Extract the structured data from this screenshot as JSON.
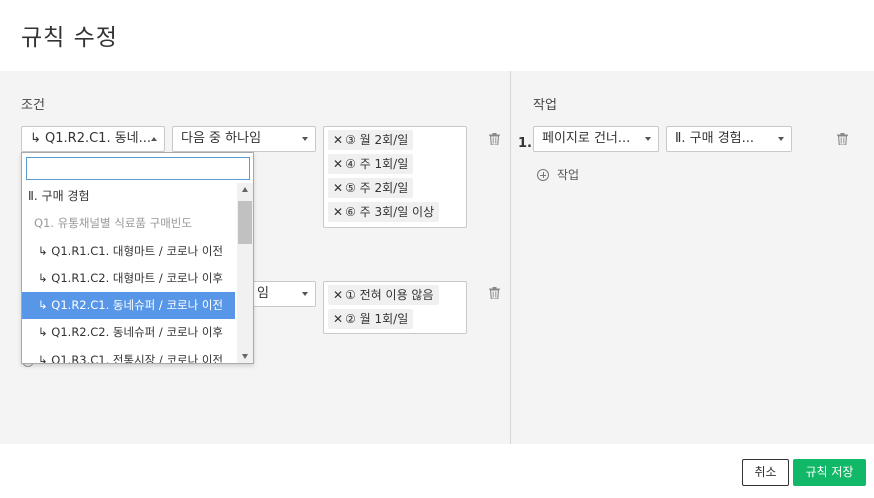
{
  "dialog": {
    "title": "규칙 수정"
  },
  "conditions": {
    "label": "조건",
    "row1": {
      "field": "↳ Q1.R2.C1. 동네...",
      "operator": "다음 중 하나임",
      "tags": [
        "③ 월 2회/일",
        "④ 주 1회/일",
        "⑤ 주 2회/일",
        "⑥ 주 3회/일 이상"
      ]
    },
    "row2": {
      "operator": "임",
      "tags": [
        "① 전혀 이용 않음",
        "② 월 1회/일"
      ]
    }
  },
  "dropdown": {
    "search_value": "",
    "options": [
      {
        "label": "Ⅱ. 구매 경험",
        "kind": "group"
      },
      {
        "label": "Q1. 유통채널별 식료품 구매빈도",
        "kind": "subgroup"
      },
      {
        "label": "↳ Q1.R1.C1. 대형마트 / 코로나 이전",
        "kind": "item"
      },
      {
        "label": "↳ Q1.R1.C2. 대형마트 / 코로나 이후",
        "kind": "item"
      },
      {
        "label": "↳ Q1.R2.C1. 동네슈퍼 / 코로나 이전",
        "kind": "item selected"
      },
      {
        "label": "↳ Q1.R2.C2. 동네슈퍼 / 코로나 이후",
        "kind": "item"
      },
      {
        "label": "↳ Q1.R3.C1. 전통시장 / 코로나 이전",
        "kind": "item"
      }
    ]
  },
  "actions": {
    "label": "작업",
    "row1": {
      "number": "1.",
      "action": "페이지로 건너...",
      "target": "Ⅱ. 구매 경험..."
    },
    "add_label": "작업"
  },
  "footer": {
    "cancel_label": "취소",
    "save_label": "규칙 저장"
  },
  "colors": {
    "accent": "#10b868",
    "selected": "#5897e8",
    "panel": "#f3f4f3"
  }
}
